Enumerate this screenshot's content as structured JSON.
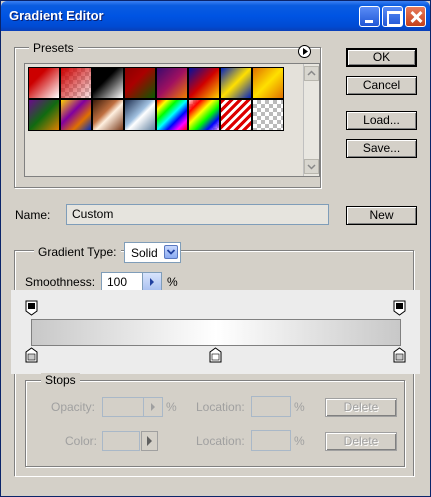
{
  "window": {
    "title": "Gradient Editor"
  },
  "presets": {
    "label": "Presets",
    "swatches": [
      "fg-to-bg",
      "fg-to-transparent",
      "black-white",
      "red-green",
      "violet-orange",
      "blue-red-yellow",
      "blue-yellow-blue",
      "orange-yellow-orange",
      "violet-green-orange",
      "yellow-violet-orange-blue",
      "copper",
      "chrome",
      "spectrum",
      "transparent-rainbow",
      "transparent-stripes",
      "transparent"
    ]
  },
  "buttons": {
    "ok": "OK",
    "cancel": "Cancel",
    "load": "Load...",
    "save": "Save...",
    "new": "New",
    "delete_opacity": "Delete",
    "delete_color": "Delete"
  },
  "name_field": {
    "label": "Name:",
    "value": "Custom"
  },
  "gradient_type": {
    "label": "Gradient Type:",
    "selected": "Solid"
  },
  "smoothness": {
    "label": "Smoothness:",
    "value": "100",
    "unit": "%"
  },
  "gradient": {
    "color_stops": [
      0,
      50,
      100
    ],
    "opacity_stops": [
      0,
      100
    ],
    "colors": [
      "#c8c8c8",
      "#ffffff",
      "#c8c8c8"
    ]
  },
  "stops": {
    "label": "Stops",
    "opacity_label": "Opacity:",
    "opacity_value": "",
    "opacity_unit": "%",
    "location_label_1": "Location:",
    "location_unit_1": "%",
    "color_label": "Color:",
    "location_label_2": "Location:",
    "location_unit_2": "%"
  }
}
